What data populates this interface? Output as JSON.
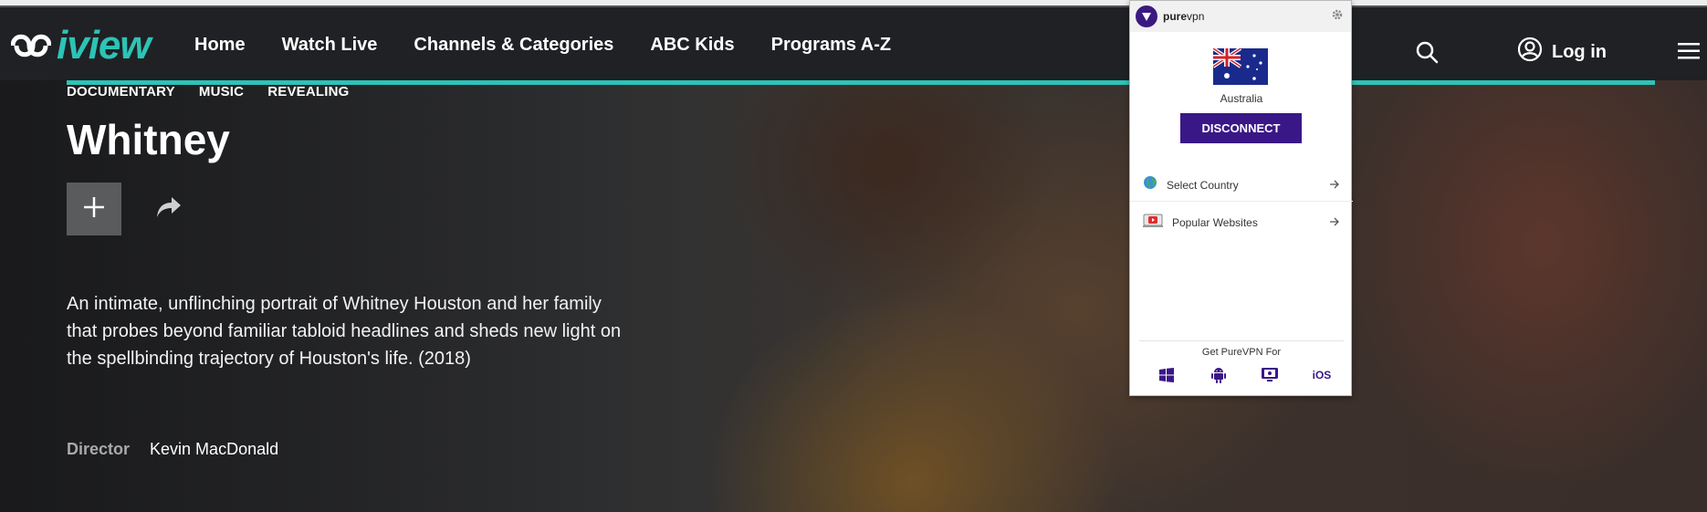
{
  "nav": {
    "logo_text": "iview",
    "links": [
      "Home",
      "Watch Live",
      "Channels & Categories",
      "ABC Kids",
      "Programs A-Z"
    ],
    "login_label": "Log in"
  },
  "program": {
    "tags": [
      "DOCUMENTARY",
      "MUSIC",
      "REVEALING"
    ],
    "title": "Whitney",
    "description": "An intimate, unflinching portrait of Whitney Houston and her family that probes beyond familiar tabloid headlines and sheds new light on the spellbinding trajectory of Houston's life. (2018)",
    "credit_label": "Director",
    "credit_value": "Kevin MacDonald"
  },
  "vpn": {
    "brand_bold": "pure",
    "brand_rest": "vpn",
    "country": "Australia",
    "disconnect_label": "DISCONNECT",
    "menu": [
      "Select Country",
      "Popular Websites"
    ],
    "get_for": "Get PureVPN For",
    "ios_label": "iOS",
    "accent": "#3a1787"
  },
  "colors": {
    "teal": "#2dc3b6",
    "nav_bg": "#1f2124"
  }
}
